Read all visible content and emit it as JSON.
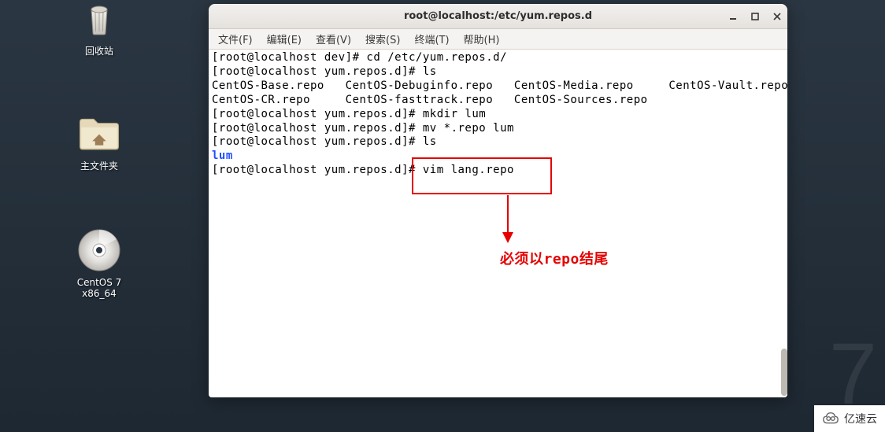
{
  "desktop": {
    "trash": {
      "label": "回收站"
    },
    "home": {
      "label": "主文件夹"
    },
    "disc": {
      "label": "CentOS 7 x86_64"
    }
  },
  "watermark_big": "7",
  "watermark_badge": "亿速云",
  "window": {
    "title": "root@localhost:/etc/yum.repos.d",
    "menus": {
      "file": "文件(F)",
      "edit": "编辑(E)",
      "view": "查看(V)",
      "search": "搜索(S)",
      "term": "终端(T)",
      "help": "帮助(H)"
    },
    "term_lines": {
      "l1": "[root@localhost dev]# cd /etc/yum.repos.d/",
      "l2": "[root@localhost yum.repos.d]# ls",
      "l3": "CentOS-Base.repo   CentOS-Debuginfo.repo   CentOS-Media.repo     CentOS-Vault.repo",
      "l4": "CentOS-CR.repo     CentOS-fasttrack.repo   CentOS-Sources.repo",
      "l5": "[root@localhost yum.repos.d]# mkdir lum",
      "l6": "[root@localhost yum.repos.d]# mv *.repo lum",
      "l7": "[root@localhost yum.repos.d]# ls",
      "l8": "lum",
      "l9": "[root@localhost yum.repos.d]# vim lang.repo"
    },
    "annotation": "必须以repo结尾"
  }
}
